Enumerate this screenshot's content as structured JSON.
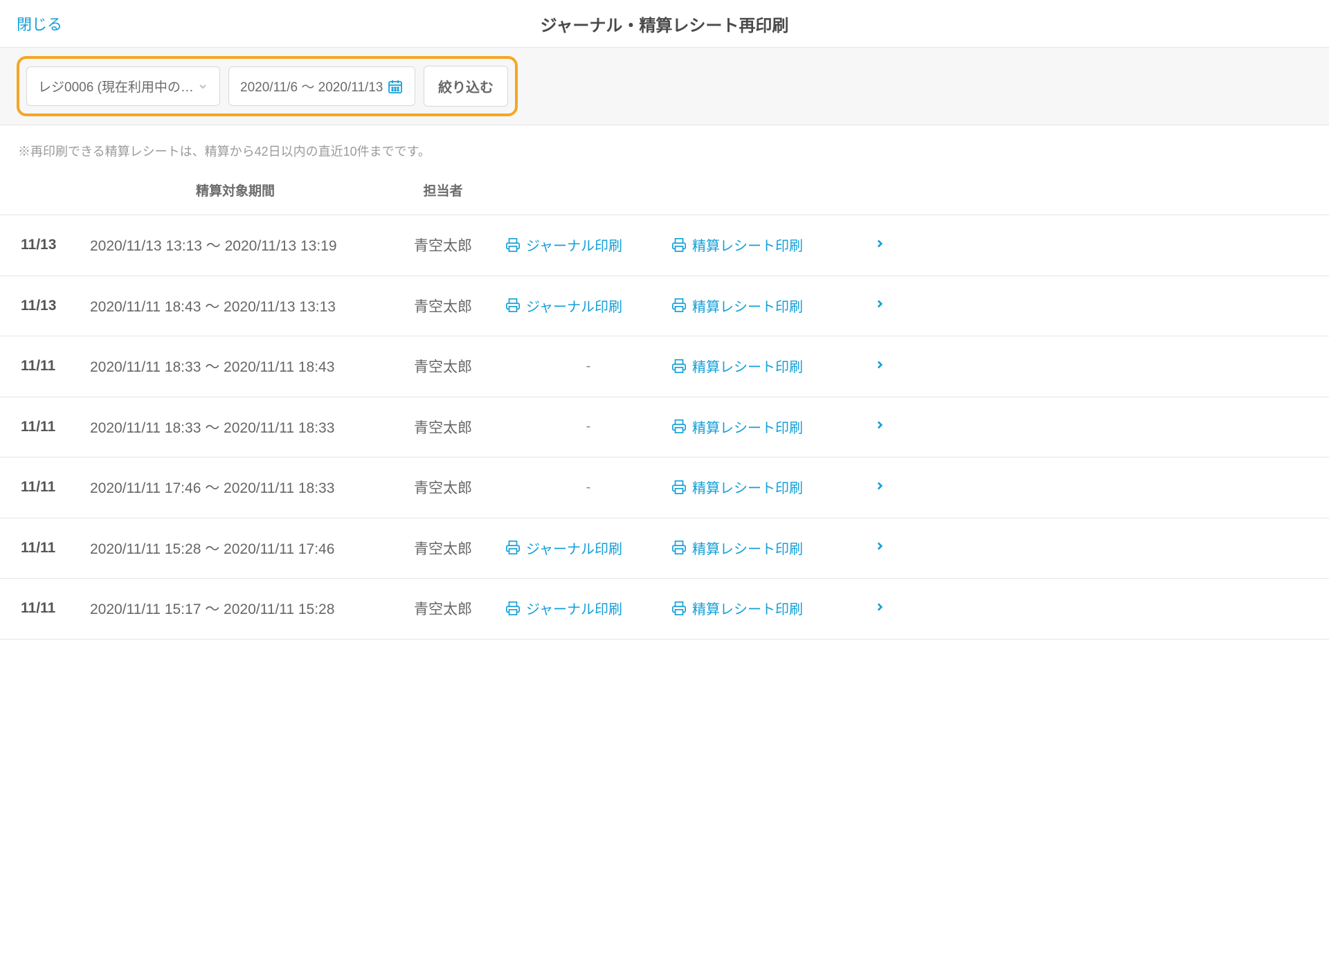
{
  "header": {
    "close_label": "閉じる",
    "title": "ジャーナル・精算レシート再印刷"
  },
  "filter": {
    "register_label": "レジ0006 (現在利用中の…",
    "date_range": "2020/11/6 〜 2020/11/13",
    "apply_label": "絞り込む"
  },
  "note": "※再印刷できる精算レシートは、精算から42日以内の直近10件までです。",
  "columns": {
    "period": "精算対象期間",
    "person": "担当者"
  },
  "labels": {
    "journal_print": "ジャーナル印刷",
    "receipt_print": "精算レシート印刷",
    "dash": "-"
  },
  "rows": [
    {
      "date": "11/13",
      "period": "2020/11/13 13:13 〜 2020/11/13 13:19",
      "person": "青空太郎",
      "journal": true
    },
    {
      "date": "11/13",
      "period": "2020/11/11 18:43 〜 2020/11/13 13:13",
      "person": "青空太郎",
      "journal": true
    },
    {
      "date": "11/11",
      "period": "2020/11/11 18:33 〜 2020/11/11 18:43",
      "person": "青空太郎",
      "journal": false
    },
    {
      "date": "11/11",
      "period": "2020/11/11 18:33 〜 2020/11/11 18:33",
      "person": "青空太郎",
      "journal": false
    },
    {
      "date": "11/11",
      "period": "2020/11/11 17:46 〜 2020/11/11 18:33",
      "person": "青空太郎",
      "journal": false
    },
    {
      "date": "11/11",
      "period": "2020/11/11 15:28 〜 2020/11/11 17:46",
      "person": "青空太郎",
      "journal": true
    },
    {
      "date": "11/11",
      "period": "2020/11/11 15:17 〜 2020/11/11 15:28",
      "person": "青空太郎",
      "journal": true
    }
  ]
}
